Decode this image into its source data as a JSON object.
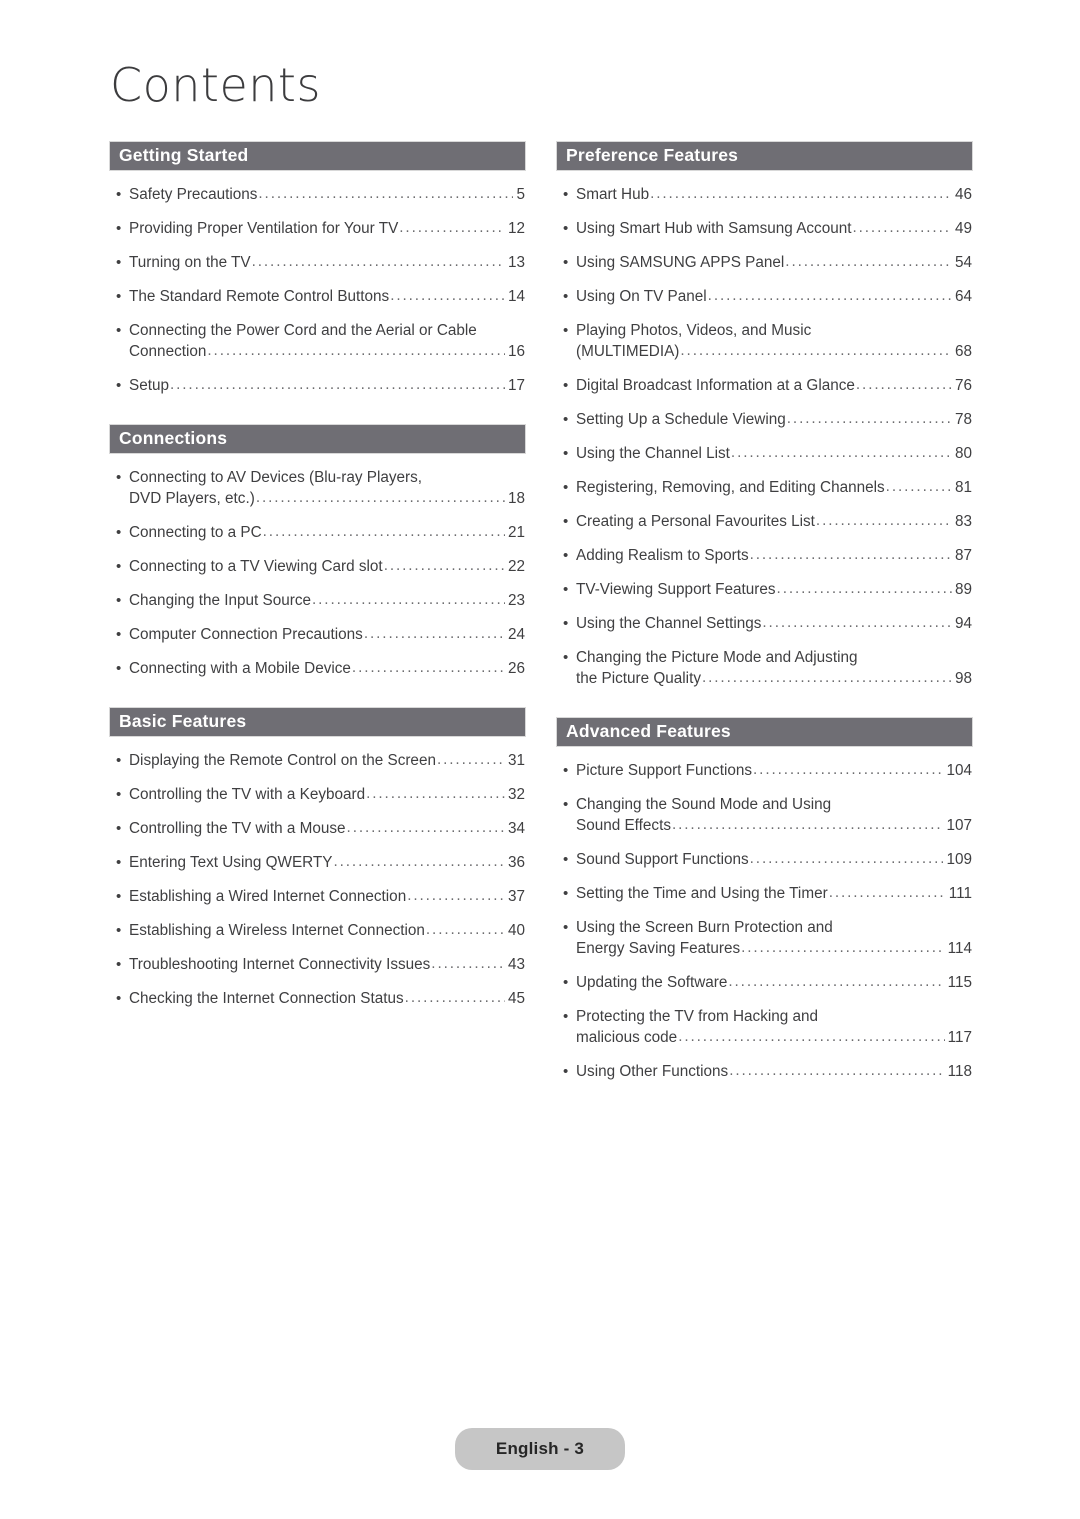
{
  "page": {
    "title": "Contents",
    "footer_label": "English - 3",
    "bullet_glyph": "•",
    "leader_char": ".",
    "colors": {
      "section_bar": "#6f6e74",
      "section_bar_text": "#ffffff",
      "body_text": "#3f3f41",
      "title_text": "#3c3c3e",
      "footer_pill": "#c6c6c6",
      "footer_text": "#262626",
      "background": "#ffffff"
    }
  },
  "columns": [
    {
      "name": "left-column",
      "sections": [
        {
          "title": "Getting Started",
          "entries": [
            {
              "text": "Safety Precautions",
              "page": "5"
            },
            {
              "text": "Providing Proper Ventilation for Your TV",
              "page": "12"
            },
            {
              "text": "Turning on the TV",
              "page": "13"
            },
            {
              "text": "The Standard Remote Control Buttons",
              "page": "14"
            },
            {
              "text": "Connecting the Power Cord and the Aerial or Cable",
              "text2": "Connection",
              "page": "16"
            },
            {
              "text": "Setup",
              "page": "17"
            }
          ]
        },
        {
          "title": "Connections",
          "entries": [
            {
              "text": "Connecting to AV Devices (Blu-ray Players,",
              "text2": "DVD Players, etc.)",
              "page": "18"
            },
            {
              "text": "Connecting to a PC",
              "page": "21"
            },
            {
              "text": "Connecting to a TV Viewing Card slot",
              "page": "22"
            },
            {
              "text": "Changing the Input Source",
              "page": "23"
            },
            {
              "text": "Computer Connection Precautions",
              "page": "24"
            },
            {
              "text": "Connecting with a Mobile Device",
              "page": "26"
            }
          ]
        },
        {
          "title": "Basic Features",
          "entries": [
            {
              "text": "Displaying the Remote Control on the Screen",
              "page": "31"
            },
            {
              "text": "Controlling the TV with a Keyboard",
              "page": "32"
            },
            {
              "text": "Controlling the TV with a Mouse",
              "page": "34"
            },
            {
              "text": "Entering Text Using QWERTY",
              "page": "36"
            },
            {
              "text": "Establishing a Wired Internet Connection",
              "page": "37"
            },
            {
              "text": "Establishing a Wireless Internet Connection",
              "page": "40"
            },
            {
              "text": "Troubleshooting Internet Connectivity Issues",
              "page": "43"
            },
            {
              "text": "Checking the Internet Connection Status",
              "page": "45"
            }
          ]
        }
      ]
    },
    {
      "name": "right-column",
      "sections": [
        {
          "title": "Preference Features",
          "entries": [
            {
              "text": "Smart Hub",
              "page": "46"
            },
            {
              "text": "Using Smart Hub with Samsung Account",
              "page": "49"
            },
            {
              "text": "Using SAMSUNG APPS Panel",
              "page": "54"
            },
            {
              "text": "Using On TV Panel",
              "page": "64"
            },
            {
              "text": "Playing Photos, Videos, and Music",
              "text2": "(MULTIMEDIA)",
              "page": "68"
            },
            {
              "text": "Digital Broadcast Information at a Glance",
              "page": "76"
            },
            {
              "text": "Setting Up a Schedule Viewing",
              "page": "78"
            },
            {
              "text": "Using the Channel List",
              "page": "80"
            },
            {
              "text": "Registering, Removing, and Editing Channels",
              "page": "81"
            },
            {
              "text": "Creating a Personal Favourites List",
              "page": "83"
            },
            {
              "text": "Adding Realism to Sports",
              "page": "87"
            },
            {
              "text": "TV-Viewing Support Features",
              "page": "89"
            },
            {
              "text": "Using the Channel Settings",
              "page": "94"
            },
            {
              "text": "Changing the Picture Mode and Adjusting",
              "text2": "the Picture Quality",
              "page": "98"
            }
          ]
        },
        {
          "title": "Advanced Features",
          "entries": [
            {
              "text": "Picture Support Functions",
              "page": "104"
            },
            {
              "text": "Changing the Sound Mode and Using",
              "text2": "Sound Effects",
              "page": "107"
            },
            {
              "text": "Sound Support Functions",
              "page": "109"
            },
            {
              "text": "Setting the Time and Using the Timer",
              "page": "111"
            },
            {
              "text": "Using the Screen Burn Protection and",
              "text2": "Energy Saving Features",
              "page": "114"
            },
            {
              "text": "Updating the Software",
              "page": "115"
            },
            {
              "text": "Protecting the TV from Hacking and",
              "text2": "malicious code",
              "page": "117"
            },
            {
              "text": "Using Other Functions",
              "page": "118"
            }
          ]
        }
      ]
    }
  ]
}
